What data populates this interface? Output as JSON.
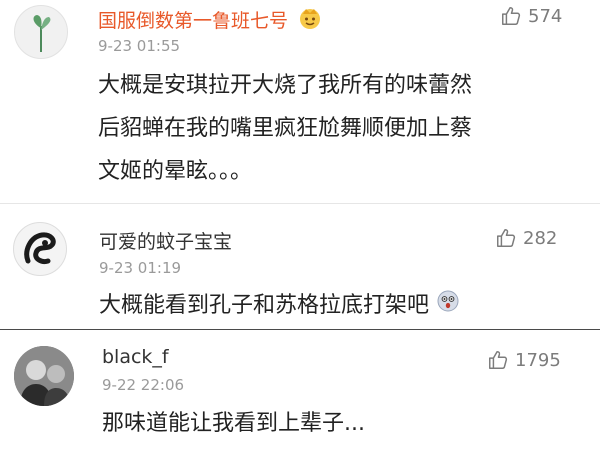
{
  "comments": [
    {
      "username": "国服倒数第一鲁班七号",
      "username_color": "#e8592a",
      "time": "9-23 01:55",
      "likes": "574",
      "lines": [
        "大概是安琪拉开大烧了我所有的味蕾然",
        "后貂蝉在我的嘴里疯狂尬舞顺便加上蔡",
        "文姬的晕眩。。。"
      ],
      "avatar_icon": "plant-sprout-icon",
      "badge_icon": "crown-emoji-icon"
    },
    {
      "username": "可爱的蚊子宝宝",
      "username_color": "#333333",
      "time": "9-23 01:19",
      "likes": "282",
      "lines": [
        "大概能看到孔子和苏格拉底打架吧"
      ],
      "avatar_icon": "ink-wash-avatar-icon",
      "trailing_icon": "shocked-emoji-icon"
    },
    {
      "username": "black_f",
      "username_color": "#333333",
      "time": "9-22 22:06",
      "likes": "1795",
      "lines": [
        "那味道能让我看到上辈子..."
      ],
      "avatar_icon": "photo-avatar-icon"
    }
  ],
  "like_icon": "thumbs-up-icon"
}
